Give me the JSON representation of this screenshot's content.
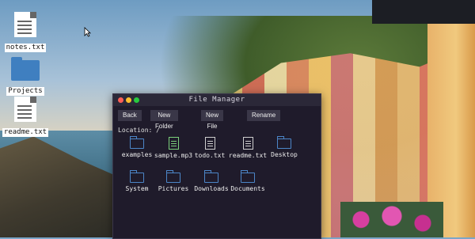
{
  "desktop": {
    "icons": [
      {
        "label": "notes.txt",
        "icon": "text-file-icon"
      },
      {
        "label": "Projects",
        "icon": "folder-icon"
      },
      {
        "label": "readme.txt",
        "icon": "text-file-icon"
      }
    ]
  },
  "window": {
    "title": "File Manager",
    "controls": {
      "close_color": "#ff5f56",
      "minimize_color": "#ffbd2e",
      "maximize_color": "#27c93f"
    },
    "toolbar": [
      "Back",
      "New Folder",
      "New File",
      "Rename"
    ],
    "location_label": "Location: /",
    "files": [
      {
        "name": "examples",
        "type": "folder"
      },
      {
        "name": "sample.mp3",
        "type": "audio"
      },
      {
        "name": "todo.txt",
        "type": "text"
      },
      {
        "name": "readme.txt",
        "type": "text"
      },
      {
        "name": "Desktop",
        "type": "folder"
      },
      {
        "name": "System",
        "type": "folder"
      },
      {
        "name": "Pictures",
        "type": "folder"
      },
      {
        "name": "Downloads",
        "type": "folder"
      },
      {
        "name": "Documents",
        "type": "folder"
      }
    ]
  }
}
